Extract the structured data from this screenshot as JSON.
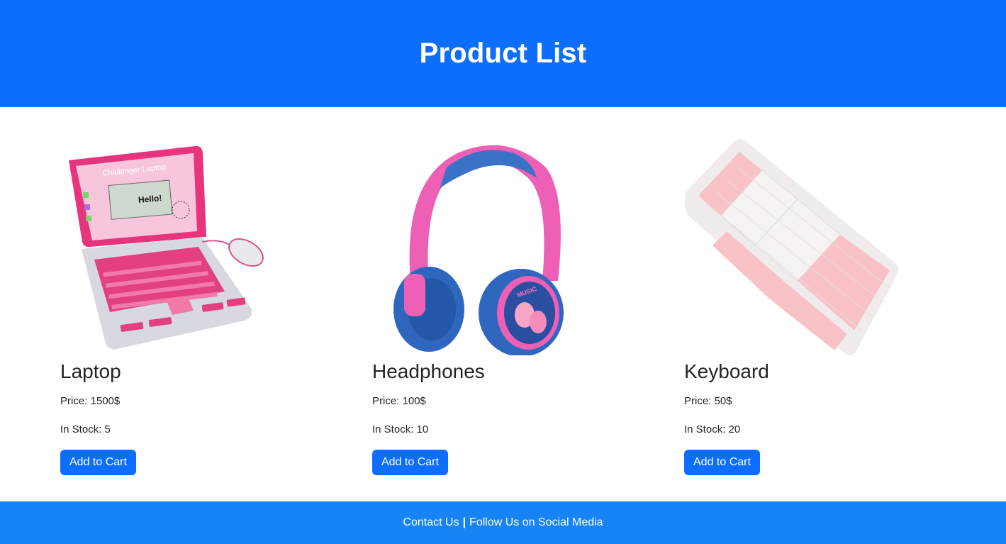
{
  "header": {
    "title": "Product List"
  },
  "products": [
    {
      "name": "Laptop",
      "price": "Price: 1500$",
      "stock": "In Stock: 5",
      "button": "Add to Cart",
      "image": "pink-toy-laptop"
    },
    {
      "name": "Headphones",
      "price": "Price: 100$",
      "stock": "In Stock: 10",
      "button": "Add to Cart",
      "image": "pink-blue-headphones"
    },
    {
      "name": "Keyboard",
      "price": "Price: 50$",
      "stock": "In Stock: 20",
      "button": "Add to Cart",
      "image": "pink-white-keyboard"
    }
  ],
  "footer": {
    "contact": "Contact Us",
    "separator": "|",
    "social": "Follow Us on Social Media"
  },
  "colors": {
    "primary": "#0d6efd",
    "footer": "#1684f5",
    "text": "#212529"
  }
}
